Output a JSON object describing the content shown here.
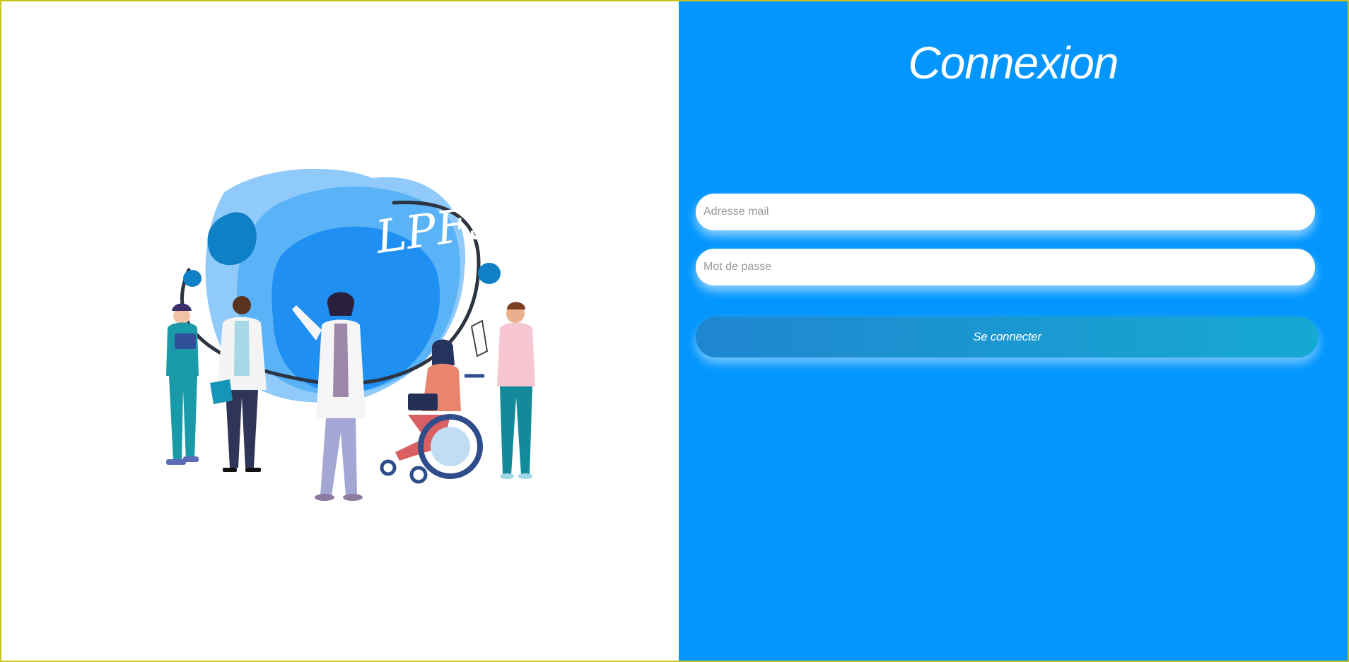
{
  "login": {
    "title": "Connexion",
    "email_placeholder": "Adresse mail",
    "password_placeholder": "Mot de passe",
    "submit_label": "Se connecter"
  },
  "illustration": {
    "logo_text": "LPFS"
  },
  "colors": {
    "panel_bg": "#0396fe",
    "button_gradient_start": "#1f86d0",
    "button_gradient_end": "#16a9d2",
    "input_bg": "#ffffff"
  }
}
